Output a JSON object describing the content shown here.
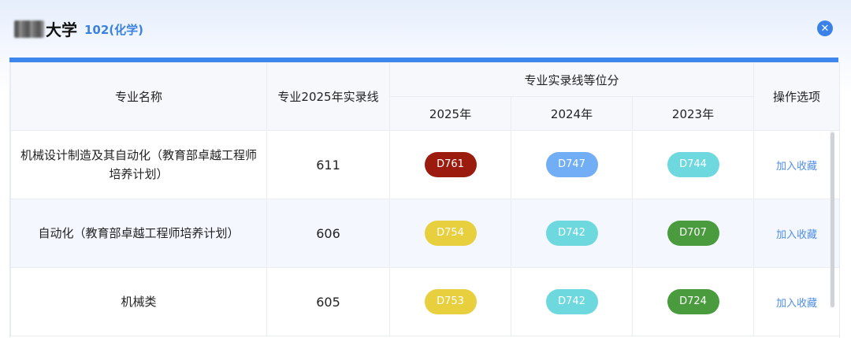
{
  "header": {
    "title": "大学",
    "subtitle": "102(化学)",
    "close_icon": "close-icon"
  },
  "colors": {
    "accent": "#3c86ee",
    "pill_dark_red": "#9b1c0e",
    "pill_blue": "#71aef5",
    "pill_cyan": "#6dd9de",
    "pill_yellow": "#e8cf3e",
    "pill_green": "#4a9b3e"
  },
  "table": {
    "headers": {
      "name": "专业名称",
      "line": "专业2025年实录线",
      "equiv": "专业实录线等位分",
      "y2025": "2025年",
      "y2024": "2024年",
      "y2023": "2023年",
      "action": "操作选项"
    },
    "rows": [
      {
        "name": "机械设计制造及其自动化（教育部卓越工程师培养计划）",
        "score": "611",
        "p2025": {
          "text": "D761",
          "color": "#9b1c0e"
        },
        "p2024": {
          "text": "D747",
          "color": "#71aef5"
        },
        "p2023": {
          "text": "D744",
          "color": "#6dd9de"
        },
        "action": "加入收藏"
      },
      {
        "name": "自动化（教育部卓越工程师培养计划）",
        "score": "606",
        "p2025": {
          "text": "D754",
          "color": "#e8cf3e"
        },
        "p2024": {
          "text": "D742",
          "color": "#6dd9de"
        },
        "p2023": {
          "text": "D707",
          "color": "#4a9b3e"
        },
        "action": "加入收藏"
      },
      {
        "name": "机械类",
        "score": "605",
        "p2025": {
          "text": "D753",
          "color": "#e8cf3e"
        },
        "p2024": {
          "text": "D742",
          "color": "#6dd9de"
        },
        "p2023": {
          "text": "D724",
          "color": "#4a9b3e"
        },
        "action": "加入收藏"
      }
    ]
  }
}
